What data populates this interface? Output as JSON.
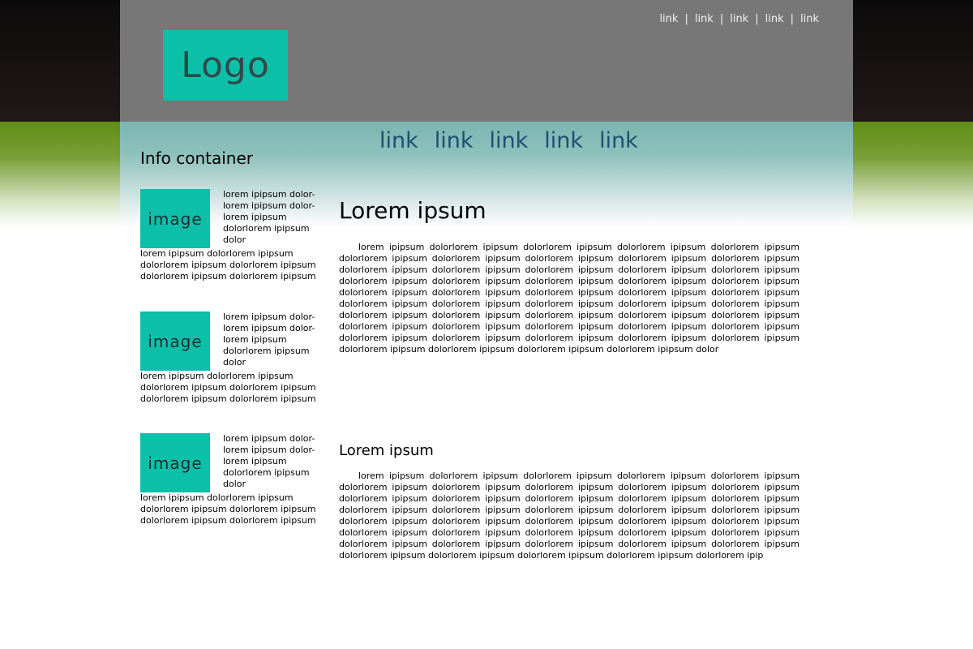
{
  "header": {
    "logo_text": "Logo",
    "top_links": [
      "link",
      "link",
      "link",
      "link",
      "link"
    ]
  },
  "nav": {
    "links": [
      "link",
      "link",
      "link",
      "link",
      "link"
    ]
  },
  "sidebar": {
    "title": "Info container",
    "items": [
      {
        "image_label": "image",
        "side_text": "lorem ipipsum dolor-lorem ipipsum dolor-lorem ipipsum dolorlorem ipipsum dolor",
        "below_text": "lorem ipipsum dolorlorem ipipsum dolorlorem ipipsum dolorlorem ipipsum dolorlorem ipipsum dolorlorem ipipsum"
      },
      {
        "image_label": "image",
        "side_text": "lorem ipipsum dolor-lorem ipipsum dolor-lorem ipipsum dolorlorem ipipsum dolor",
        "below_text": "lorem ipipsum dolorlorem ipipsum dolorlorem ipipsum dolorlorem ipipsum dolorlorem ipipsum dolorlorem ipipsum"
      },
      {
        "image_label": "image",
        "side_text": "lorem ipipsum dolor-lorem ipipsum dolor-lorem ipipsum dolorlorem ipipsum dolor",
        "below_text": "lorem ipipsum dolorlorem ipipsum dolorlorem ipipsum dolorlorem ipipsum dolorlorem ipipsum dolorlorem ipipsum"
      }
    ]
  },
  "main": {
    "heading1": "Lorem ipsum",
    "paragraph1": "lorem ipipsum dolorlorem ipipsum dolorlorem ipipsum dolorlorem ipipsum dolorlorem ipipsum dolorlorem ipipsum dolorlorem ipipsum dolorlorem ipipsum dolorlorem ipipsum dolorlorem ipipsum dolorlorem ipipsum dolorlorem ipipsum dolorlorem ipipsum dolorlorem ipipsum dolorlorem ipipsum dolorlorem ipipsum dolorlorem ipipsum dolorlorem ipipsum dolorlorem ipipsum dolorlorem ipipsum dolorlorem ipipsum dolorlorem ipipsum dolorlorem ipipsum dolorlorem ipipsum dolorlorem ipipsum dolorlorem ipipsum dolorlorem ipipsum dolorlorem ipipsum dolorlorem ipipsum dolorlorem ipipsum dolorlorem ipipsum dolorlorem ipipsum dolorlorem ipipsum dolorlorem ipipsum dolorlorem ipipsum dolorlorem ipipsum dolorlorem ipipsum dolorlorem ipipsum dolorlorem ipipsum dolorlorem ipipsum dolorlorem ipipsum dolorlorem ipipsum dolorlorem ipipsum dolorlorem ipipsum dolorlorem ipipsum dolorlorem ipipsum dolorlorem ipipsum dolorlorem ipipsum dolorlorem ipipsum dolor",
    "heading2": "Lorem ipsum",
    "paragraph2": "lorem ipipsum dolorlorem ipipsum dolorlorem ipipsum dolorlorem ipipsum dolorlorem ipipsum dolorlorem ipipsum dolorlorem ipipsum dolorlorem ipipsum dolorlorem ipipsum dolorlorem ipipsum dolorlorem ipipsum dolorlorem ipipsum dolorlorem ipipsum dolorlorem ipipsum dolorlorem ipipsum dolorlorem ipipsum dolorlorem ipipsum dolorlorem ipipsum dolorlorem ipipsum dolorlorem ipipsum dolorlorem ipipsum dolorlorem ipipsum dolorlorem ipipsum dolorlorem ipipsum dolorlorem ipipsum dolorlorem ipipsum dolorlorem ipipsum dolorlorem ipipsum dolorlorem ipipsum dolorlorem ipipsum dolorlorem ipipsum dolorlorem ipipsum dolorlorem ipipsum dolorlorem ipipsum dolorlorem ipipsum dolorlorem ipipsum dolorlorem ipipsum dolorlorem ipipsum dolorlorem ipipsum dolorlorem ipip"
  },
  "colors": {
    "accent_teal": "#0cbfa9",
    "header_gray": "#777777",
    "nav_link": "#1d4f72",
    "side_green": "#5f8e14"
  }
}
